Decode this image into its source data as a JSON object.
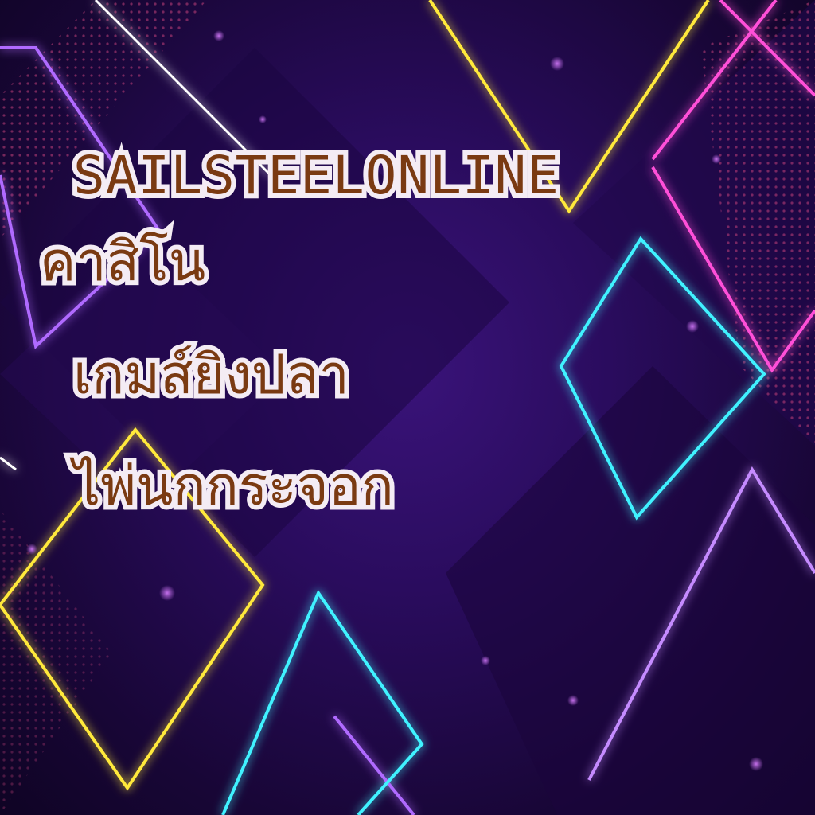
{
  "banner": {
    "brand": "SAILSTEELONLINE",
    "line_1": "คาสิโน",
    "line_2": "เกมส์ยิงปลา",
    "line_3": "ไพ่นกกระจอก"
  },
  "colors": {
    "background": "#2a0c5e",
    "text_fill": "#7a3a12",
    "text_outline": "#f4ecf4",
    "neon_yellow": "#ffe93b",
    "neon_pink": "#ff4fd8",
    "neon_violet": "#b06bff",
    "neon_cyan": "#3ff2ff"
  }
}
